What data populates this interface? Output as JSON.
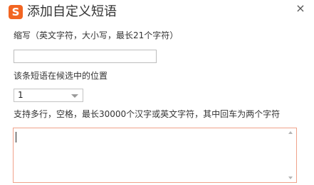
{
  "window": {
    "title": "添加自定义短语",
    "logo_glyph": "S",
    "logo_icon": "sogou-logo-icon",
    "close_glyph": "×",
    "close_icon": "close-icon"
  },
  "colors": {
    "logo_bg": "#f26522",
    "focus_border": "#f0a28a"
  },
  "form": {
    "abbr_label": "缩写（英文字符，大小写，最长21个字符）",
    "abbr_value": "",
    "position_label": "该条短语在候选中的位置",
    "position_value": "1",
    "content_label": "支持多行，空格，最长30000个汉字或英文字符，其中回车为两个字符",
    "content_value": ""
  }
}
